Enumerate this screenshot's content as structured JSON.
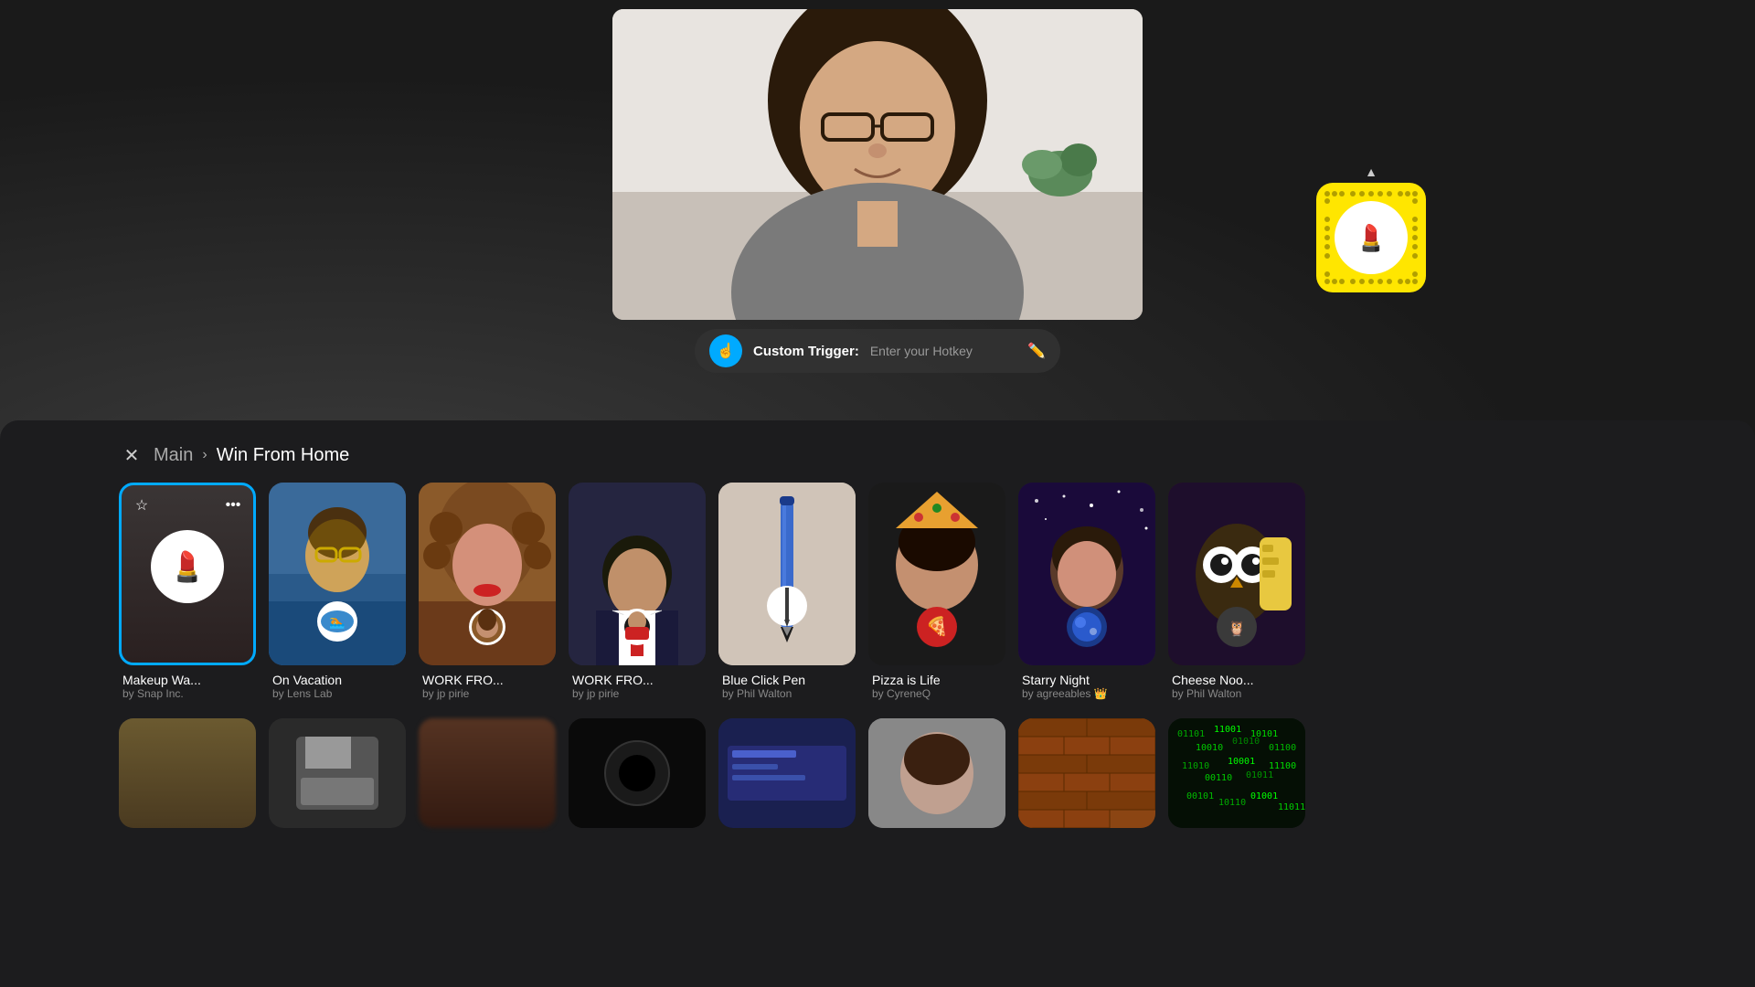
{
  "background": {
    "color": "#2a2a2a"
  },
  "trigger": {
    "label": "Custom Trigger:",
    "placeholder": "Enter your Hotkey",
    "icon": "👆"
  },
  "breadcrumb": {
    "close_label": "×",
    "main_label": "Main",
    "chevron": "›",
    "current": "Win From Home"
  },
  "snapcode": {
    "chevron": "▲"
  },
  "lenses_row1": [
    {
      "name": "Makeup Wa...",
      "author": "by Snap Inc.",
      "verified": false,
      "selected": true,
      "icon": "💄",
      "bg_class": "lens-bg-1"
    },
    {
      "name": "On Vacation",
      "author": "by Lens Lab",
      "verified": false,
      "selected": false,
      "icon": "🏖️",
      "bg_class": "lens-bg-2"
    },
    {
      "name": "WORK FRO...",
      "author": "by jp pirie",
      "verified": false,
      "selected": false,
      "icon": "👨",
      "bg_class": "lens-bg-3"
    },
    {
      "name": "WORK FRO...",
      "author": "by jp pirie",
      "verified": false,
      "selected": false,
      "icon": "👨‍💼",
      "bg_class": "lens-bg-4"
    },
    {
      "name": "Blue Click Pen",
      "author": "by Phil Walton",
      "verified": false,
      "selected": false,
      "icon": "🖊️",
      "bg_class": "lens-bg-5"
    },
    {
      "name": "Pizza is Life",
      "author": "by CyreneQ",
      "verified": false,
      "selected": false,
      "icon": "🍕",
      "bg_class": "lens-bg-6"
    },
    {
      "name": "Starry Night",
      "author": "by agreeables",
      "verified": true,
      "selected": false,
      "icon": "🌌",
      "bg_class": "lens-bg-7"
    },
    {
      "name": "Cheese Noo...",
      "author": "by Phil Walton",
      "verified": false,
      "selected": false,
      "icon": "🦉",
      "bg_class": "lens-bg-8"
    }
  ],
  "lenses_row2": [
    {
      "bg_class": "lens-bg-8",
      "color": "#6b5a30"
    },
    {
      "bg_class": "lens-bg-1",
      "color": "#2a2a2a"
    },
    {
      "bg_class": "lens-bg-3",
      "color": "#553322"
    },
    {
      "bg_class": "lens-bg-1",
      "color": "#111"
    },
    {
      "bg_class": "lens-bg-4",
      "color": "#1a2050"
    },
    {
      "bg_class": "lens-bg-5",
      "color": "#999"
    },
    {
      "bg_class": "lens-bg-6",
      "color": "#8b4513"
    },
    {
      "bg_class": "lens-bg-7",
      "color": "#2a1040"
    }
  ]
}
